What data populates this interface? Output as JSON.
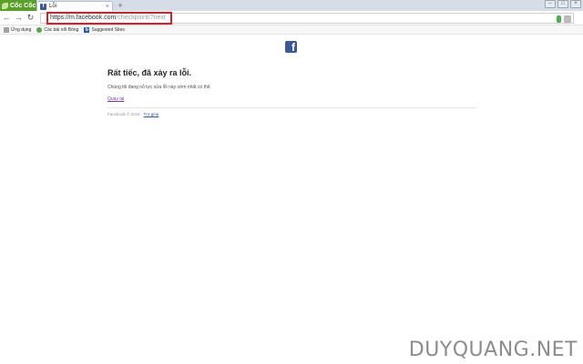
{
  "browser": {
    "brand": "Cốc Cốc",
    "tab": {
      "title": "Lỗi",
      "favicon": "facebook-icon",
      "close": "×"
    },
    "new_tab": "+",
    "window_controls": [
      "–",
      "□",
      "×"
    ]
  },
  "toolbar": {
    "url_host": "https://m.facebook.com",
    "url_path": "/checkpoint/?next"
  },
  "bookmarks": [
    {
      "label": "Ứng dụng",
      "icon": "apps-grid-icon"
    },
    {
      "label": "Các bài nổi Bóng",
      "icon": "globe-icon"
    },
    {
      "label": "Suggested Sites",
      "icon": "bing-icon"
    }
  ],
  "content": {
    "heading": "Rất tiếc, đã xảy ra lỗi.",
    "message": "Chúng tôi đang nỗ lực sửa lỗi này sớm nhất có thể.",
    "back_link": "Quay lại",
    "footer_text": "Facebook © 2016 · ",
    "footer_help": "Trợ giúp"
  },
  "watermark": "DUYQUANG.NET",
  "colors": {
    "facebook_blue": "#3b5998",
    "highlight_red": "#e01b22",
    "brand_green": "#5b9e2b"
  }
}
